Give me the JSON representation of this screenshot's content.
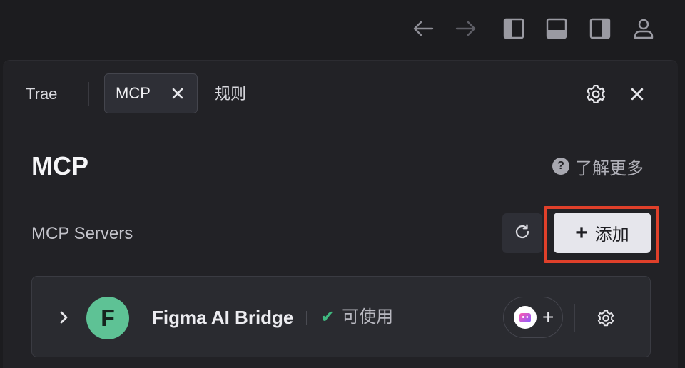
{
  "toolbar": {
    "icons": [
      "arrow-left-icon",
      "arrow-right-icon",
      "layout-left-icon",
      "layout-bottom-icon",
      "layout-right-icon",
      "account-icon"
    ]
  },
  "tabs": {
    "trae_label": "Trae",
    "mcp_label": "MCP",
    "rules_label": "规则"
  },
  "page": {
    "title": "MCP",
    "learn_more": "了解更多",
    "learn_more_icon": "?"
  },
  "servers": {
    "section_label": "MCP Servers",
    "add_label": "添加",
    "add_plus": "+",
    "items": [
      {
        "avatar_letter": "F",
        "name": "Figma AI Bridge",
        "status": "可使用",
        "status_check": "✔",
        "agent_plus": "+"
      }
    ]
  },
  "colors": {
    "background": "#1c1c1f",
    "panel": "#222226",
    "accent_highlight": "#e0402a",
    "status_ok": "#3fb87f",
    "avatar": "#5ec295"
  }
}
